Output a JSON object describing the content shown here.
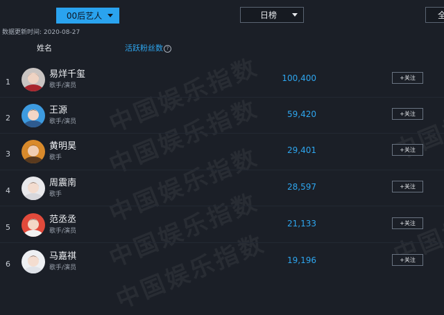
{
  "filters": {
    "category": "00后艺人",
    "period": "日榜",
    "right_button": "全"
  },
  "updated_text": "数据更新时间: 2020-08-27",
  "columns": {
    "name": "姓名",
    "fans": "活跃粉丝数"
  },
  "watermark": "中国娱乐指数",
  "rows": [
    {
      "rank": "1",
      "name": "易烊千玺",
      "role": "歌手/演员",
      "fans": "100,400",
      "follow": "+关注"
    },
    {
      "rank": "2",
      "name": "王源",
      "role": "歌手/演员",
      "fans": "59,420",
      "follow": "+关注"
    },
    {
      "rank": "3",
      "name": "黄明昊",
      "role": "歌手",
      "fans": "29,401",
      "follow": "+关注"
    },
    {
      "rank": "4",
      "name": "周震南",
      "role": "歌手",
      "fans": "28,597",
      "follow": "+关注"
    },
    {
      "rank": "5",
      "name": "范丞丞",
      "role": "歌手/演员",
      "fans": "21,133",
      "follow": "+关注"
    },
    {
      "rank": "6",
      "name": "马嘉祺",
      "role": "歌手/演员",
      "fans": "19,196",
      "follow": "+关注"
    }
  ],
  "colors": {
    "background": "#1b1f27",
    "accent": "#2aa3ef",
    "fans_text": "#2ea6ef"
  }
}
